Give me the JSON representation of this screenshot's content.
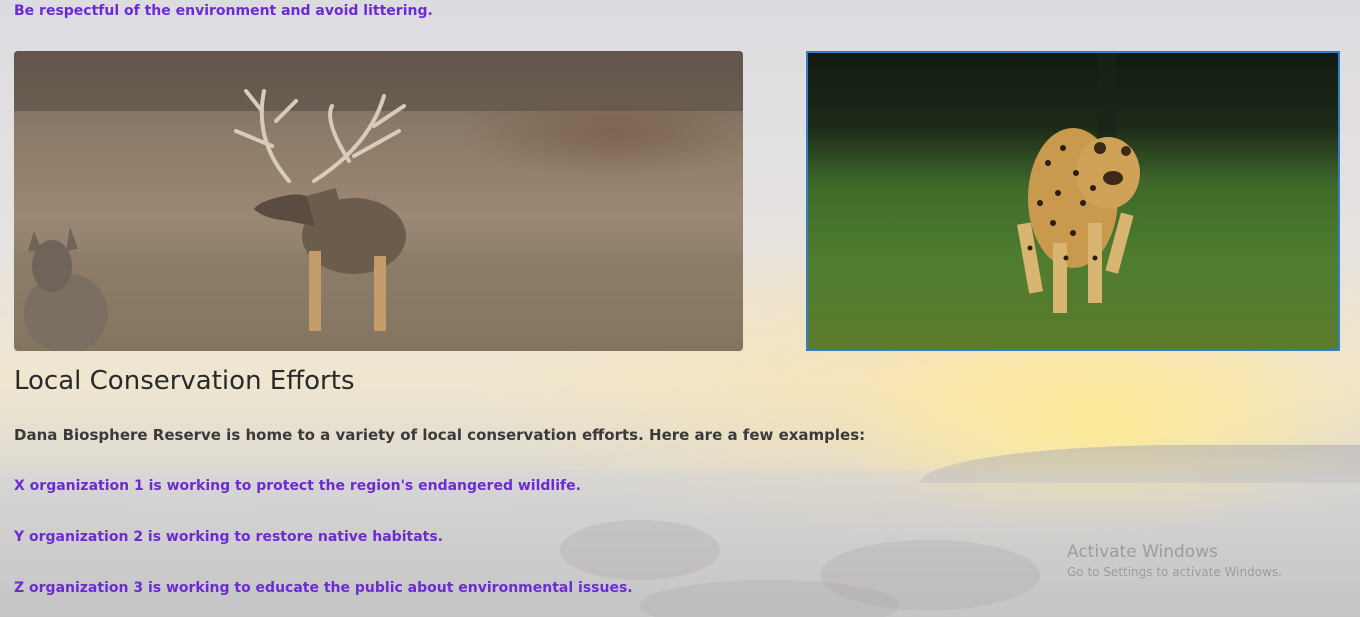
{
  "guideline": "Be respectful of the environment and avoid littering.",
  "images": {
    "deer": "Mule deer in grassland photo",
    "cheetah": "Running cheetah photo"
  },
  "conservation": {
    "heading": "Local Conservation Efforts",
    "intro": "Dana Biosphere Reserve is home to a variety of local conservation efforts. Here are a few examples:",
    "examples": [
      "X organization 1 is working to protect the region's endangered wildlife.",
      "Y organization 2 is working to restore native habitats.",
      "Z organization 3 is working to educate the public about environmental issues."
    ]
  },
  "watermark": {
    "title": "Activate Windows",
    "subtitle": "Go to Settings to activate Windows."
  },
  "colors": {
    "link_purple": "#6c2bd3",
    "image_border": "#2f7fc9"
  }
}
